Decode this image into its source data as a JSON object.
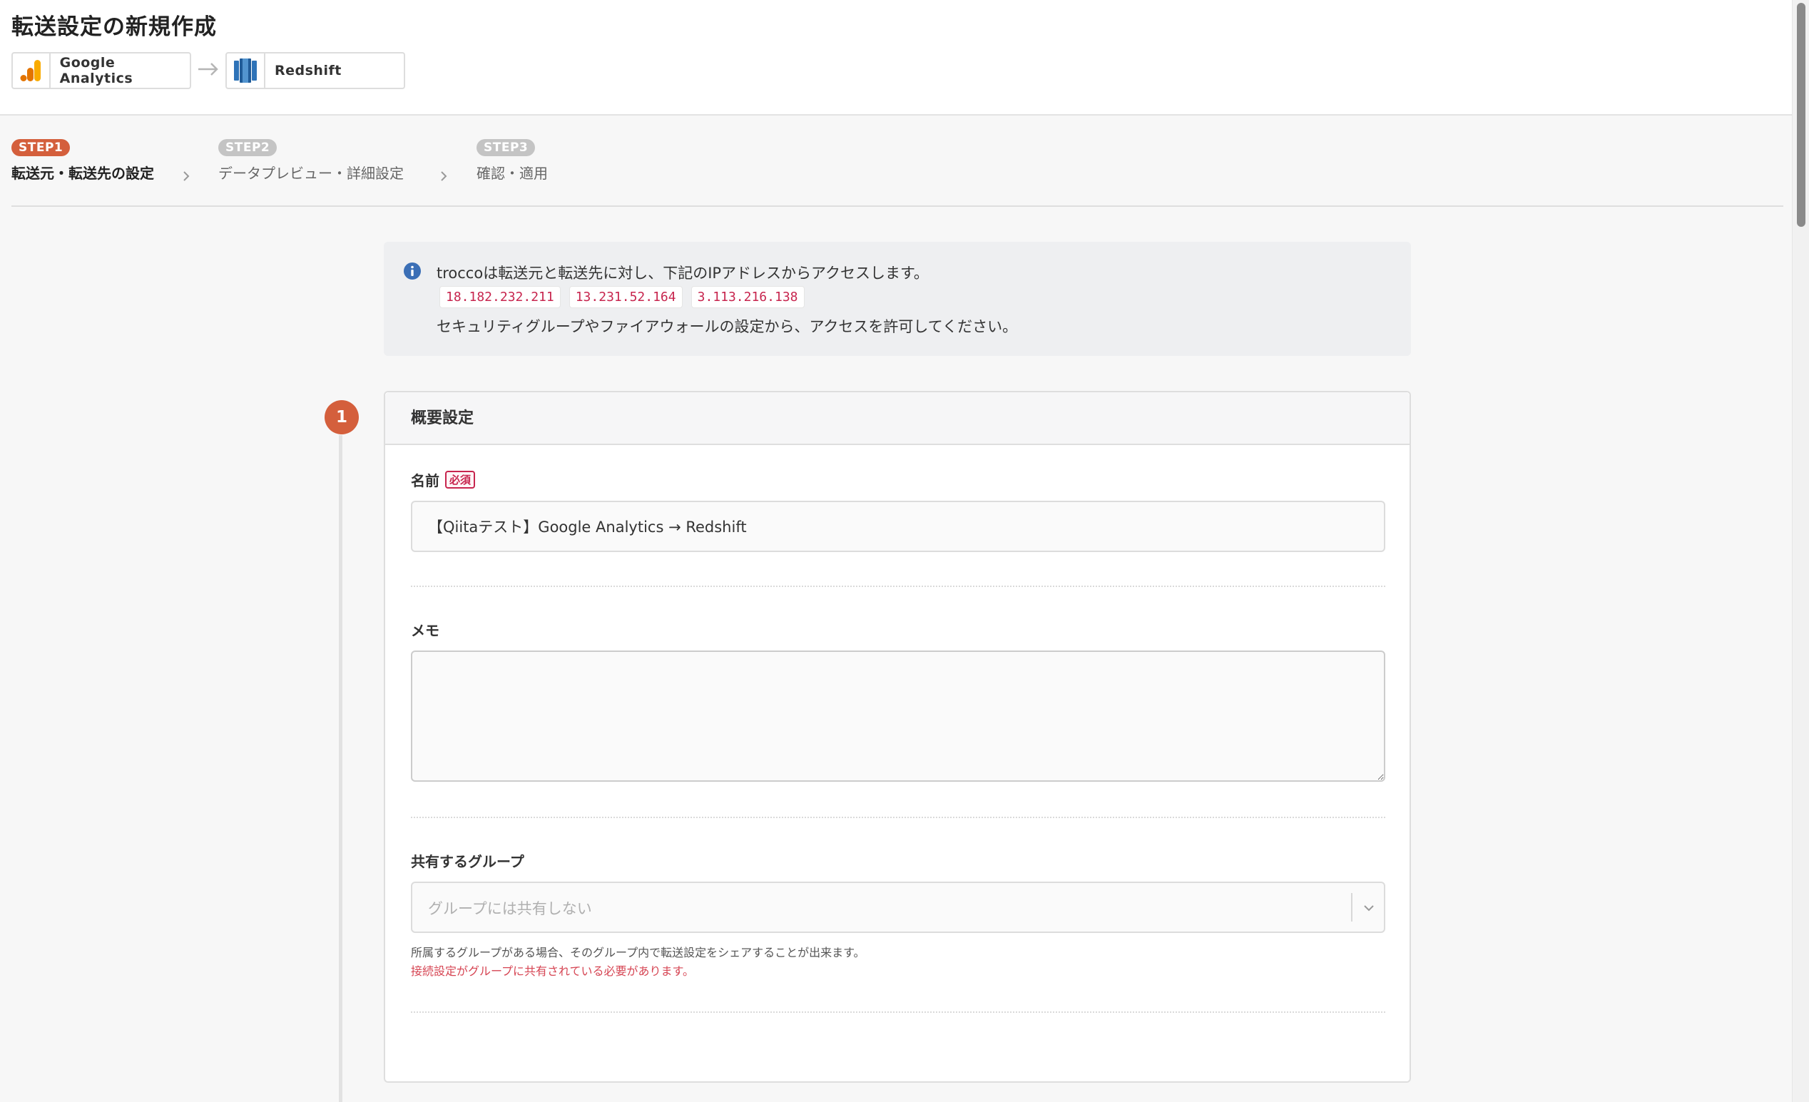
{
  "page_title": "転送設定の新規作成",
  "source": {
    "name": "Google Analytics",
    "icon": "google-analytics-logo"
  },
  "destination": {
    "name": "Redshift",
    "icon": "redshift-logo"
  },
  "steps": [
    {
      "badge": "STEP1",
      "label": "転送元・転送先の設定",
      "active": true
    },
    {
      "badge": "STEP2",
      "label": "データプレビュー・詳細設定",
      "active": false
    },
    {
      "badge": "STEP3",
      "label": "確認・適用",
      "active": false
    }
  ],
  "info": {
    "line1": "troccoは転送元と転送先に対し、下記のIPアドレスからアクセスします。",
    "ips": [
      "18.182.232.211",
      "13.231.52.164",
      "3.113.216.138"
    ],
    "line3": "セキュリティグループやファイアウォールの設定から、アクセスを許可してください。"
  },
  "section": {
    "number": "1",
    "title": "概要設定",
    "name_label": "名前",
    "required_label": "必須",
    "name_value": "【Qiitaテスト】Google Analytics → Redshift",
    "memo_label": "メモ",
    "memo_value": "",
    "group_label": "共有するグループ",
    "group_placeholder": "グループには共有しない",
    "group_help": "所属するグループがある場合、そのグループ内で転送設定をシェアすることが出来ます。",
    "group_warning": "接続設定がグループに共有されている必要があります。"
  },
  "colors": {
    "accent": "#d45f3c",
    "ip_text": "#c7254e",
    "warning": "#d64553",
    "ga_orange": "#f9ab00",
    "ga_dark_orange": "#e37400",
    "redshift_blue": "#205b98"
  }
}
